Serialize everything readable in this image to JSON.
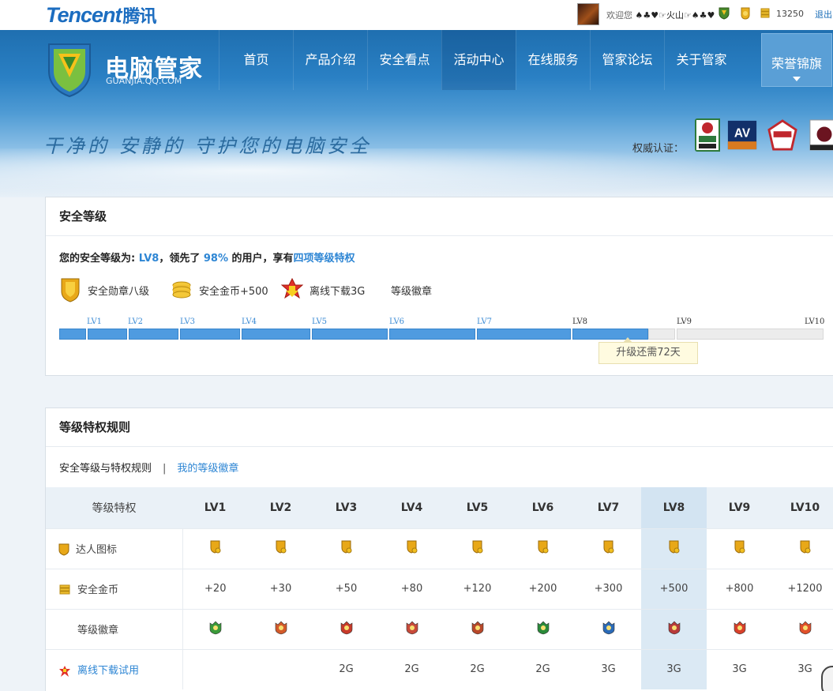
{
  "topbar": {
    "logo_text": "Tencent",
    "logo_cn": "腾讯",
    "welcome": "欢迎您",
    "username": "♠♣♥☞火山☞♠♣♥",
    "coins": "13250",
    "logout": "退出"
  },
  "header": {
    "brand": "电脑管家",
    "domain": "GUANJIA.QQ.COM",
    "nav": [
      "首页",
      "产品介绍",
      "安全看点",
      "活动中心",
      "在线服务",
      "管家论坛",
      "关于管家"
    ],
    "active_nav": "活动中心",
    "honor_button": "荣誉锦旗",
    "slogan": "干净的 安静的 守护您的电脑安全",
    "cert_label": "权威认证：",
    "certs": [
      {
        "text": "vb 100",
        "color": "#2d7a3c"
      },
      {
        "text": "AV",
        "color": "#12306a"
      },
      {
        "text": "AV TEST",
        "color": "#c0272d"
      },
      {
        "text": "Checkmark",
        "color": "#6b1420"
      }
    ]
  },
  "security_level": {
    "title": "安全等级",
    "line_prefix": "您的安全等级为: ",
    "level": "LV8",
    "line_mid": "，领先了 ",
    "percent": "98%",
    "line_mid2": " 的用户，享有",
    "link": "四项等级特权",
    "privileges": [
      {
        "label": "安全勋章八级",
        "icon": "medal-icon"
      },
      {
        "label": "安全金币+500",
        "icon": "coin-stack-icon"
      },
      {
        "label": "离线下载3G",
        "icon": "download-star-icon"
      },
      {
        "label": "等级徽章",
        "icon": "none"
      }
    ],
    "levels": [
      "LV1",
      "LV2",
      "LV3",
      "LV4",
      "LV5",
      "LV6",
      "LV7",
      "LV8",
      "LV9",
      "LV10"
    ],
    "progress_filled_levels": 8,
    "tooltip": "升级还需72天"
  },
  "rules": {
    "title": "等级特权规则",
    "tab_active": "安全等级与特权规则",
    "tab_sep": "|",
    "tab_other": "我的等级徽章",
    "header_first": "等级特权",
    "levels": [
      "LV1",
      "LV2",
      "LV3",
      "LV4",
      "LV5",
      "LV6",
      "LV7",
      "LV8",
      "LV9",
      "LV10"
    ],
    "highlight_level": "LV8",
    "rows": {
      "icon_row": "达人图标",
      "coin_row": "安全金币",
      "coin_values": [
        "+20",
        "+30",
        "+50",
        "+80",
        "+120",
        "+200",
        "+300",
        "+500",
        "+800",
        "+1200"
      ],
      "badge_row": "等级徽章",
      "badge_colors": [
        "#3a9a3a",
        "#d45a2a",
        "#c83a2a",
        "#c84a3a",
        "#b8482a",
        "#2a8a3a",
        "#2a6ab8",
        "#b83a3a",
        "#d8402a",
        "#e0502a"
      ],
      "download_row": "离线下载试用",
      "download_values": [
        "",
        "",
        "2G",
        "2G",
        "2G",
        "2G",
        "3G",
        "3G",
        "3G",
        "3G"
      ]
    }
  }
}
